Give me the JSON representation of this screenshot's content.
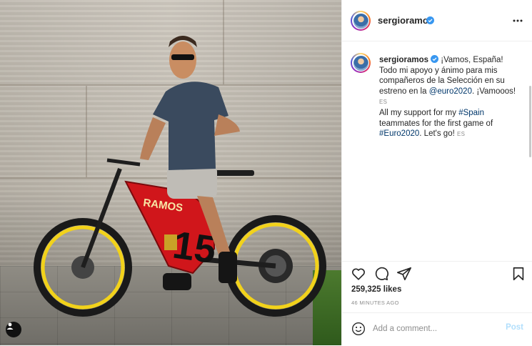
{
  "post": {
    "username": "sergioramos",
    "verified": true,
    "caption": {
      "line_es_1": "¡Vamos, España!",
      "line_es_2": "Todo mi apoyo y ánimo para mis compañeros de la Selección en su estreno en la ",
      "mention": "@euro2020",
      "line_es_3": ". ¡Vamooos!",
      "see_translation_1": "ES",
      "line_en_1": "All my support for my ",
      "hashtag_spain": "#Spain",
      "line_en_2": " teammates for the first game of ",
      "hashtag_euro": "#Euro2020",
      "line_en_3": ". Let's go!",
      "see_translation_2": "ES"
    },
    "likes": "259,325 likes",
    "time": "46 MINUTES AGO",
    "photo_text": {
      "bike_name": "RAMOS",
      "bike_number": "15"
    }
  },
  "comment": {
    "placeholder": "Add a comment...",
    "post_label": "Post"
  },
  "icons": {
    "more": "more-options-icon",
    "like": "heart-icon",
    "comment": "comment-icon",
    "share": "share-icon",
    "save": "bookmark-icon",
    "emoji": "emoji-icon",
    "tag": "user-tag-icon",
    "verified": "verified-badge-icon"
  },
  "colors": {
    "link": "#00376b",
    "verified": "#3897f0",
    "post_disabled": "#b2dffc",
    "bike_red": "#d0161b",
    "rim_yellow": "#f2d21a"
  }
}
